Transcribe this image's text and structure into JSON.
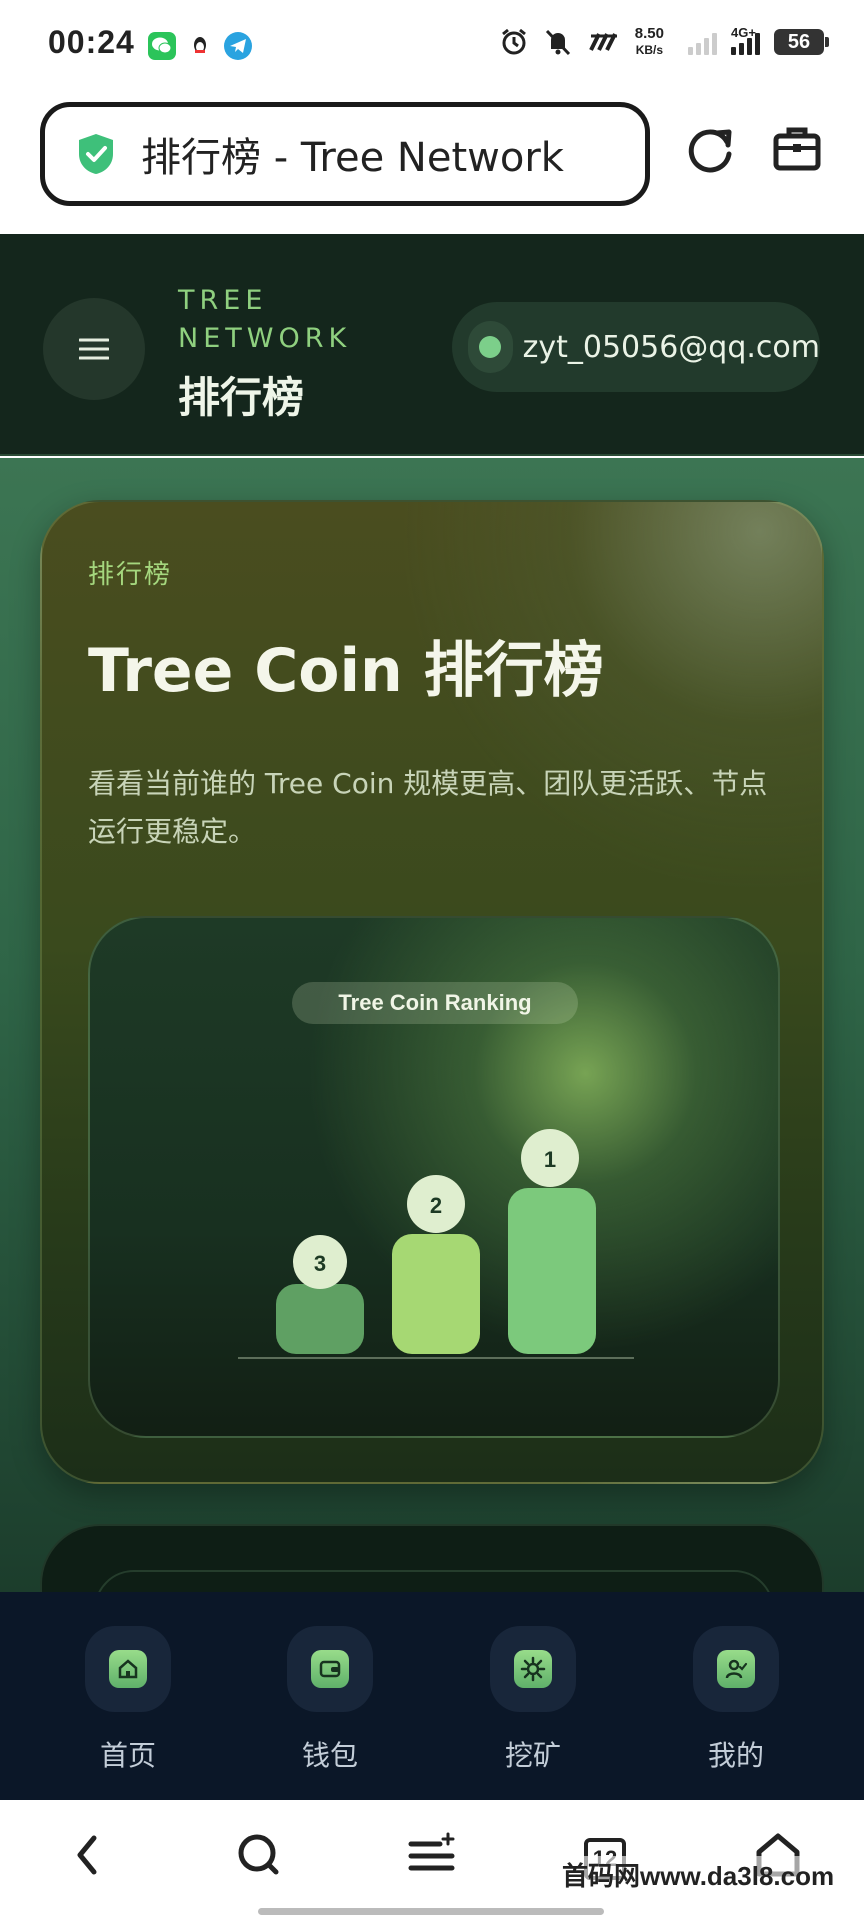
{
  "status_bar": {
    "time": "00:24",
    "speed_value": "8.50",
    "speed_unit": "KB/s",
    "network": "4G+",
    "battery": "56"
  },
  "browser": {
    "url_title": "排行榜 - Tree Network",
    "tab_count": "12",
    "watermark": "首码网www.da3l8.com"
  },
  "header": {
    "brand_line1": "TREE",
    "brand_line2": "NETWORK",
    "page_title": "排行榜",
    "user_email": "zyt_05056@qq.com"
  },
  "hero": {
    "eyebrow": "排行榜",
    "title": "Tree Coin 排行榜",
    "description": "看看当前谁的 Tree Coin 规模更高、团队更活跃、节点运行更稳定。",
    "chart_label": "Tree Coin Ranking"
  },
  "podium": [
    {
      "rank": "3",
      "color": "#5fa063"
    },
    {
      "rank": "2",
      "color": "#a6d873"
    },
    {
      "rank": "1",
      "color": "#7cc97c"
    }
  ],
  "bottom_nav": [
    {
      "label": "首页",
      "icon": "home-icon"
    },
    {
      "label": "钱包",
      "icon": "wallet-icon"
    },
    {
      "label": "挖矿",
      "icon": "mining-icon"
    },
    {
      "label": "我的",
      "icon": "profile-icon"
    }
  ],
  "colors": {
    "accent": "#8fd07f",
    "header_bg": "#14261c",
    "nav_bg": "#0b1728"
  }
}
